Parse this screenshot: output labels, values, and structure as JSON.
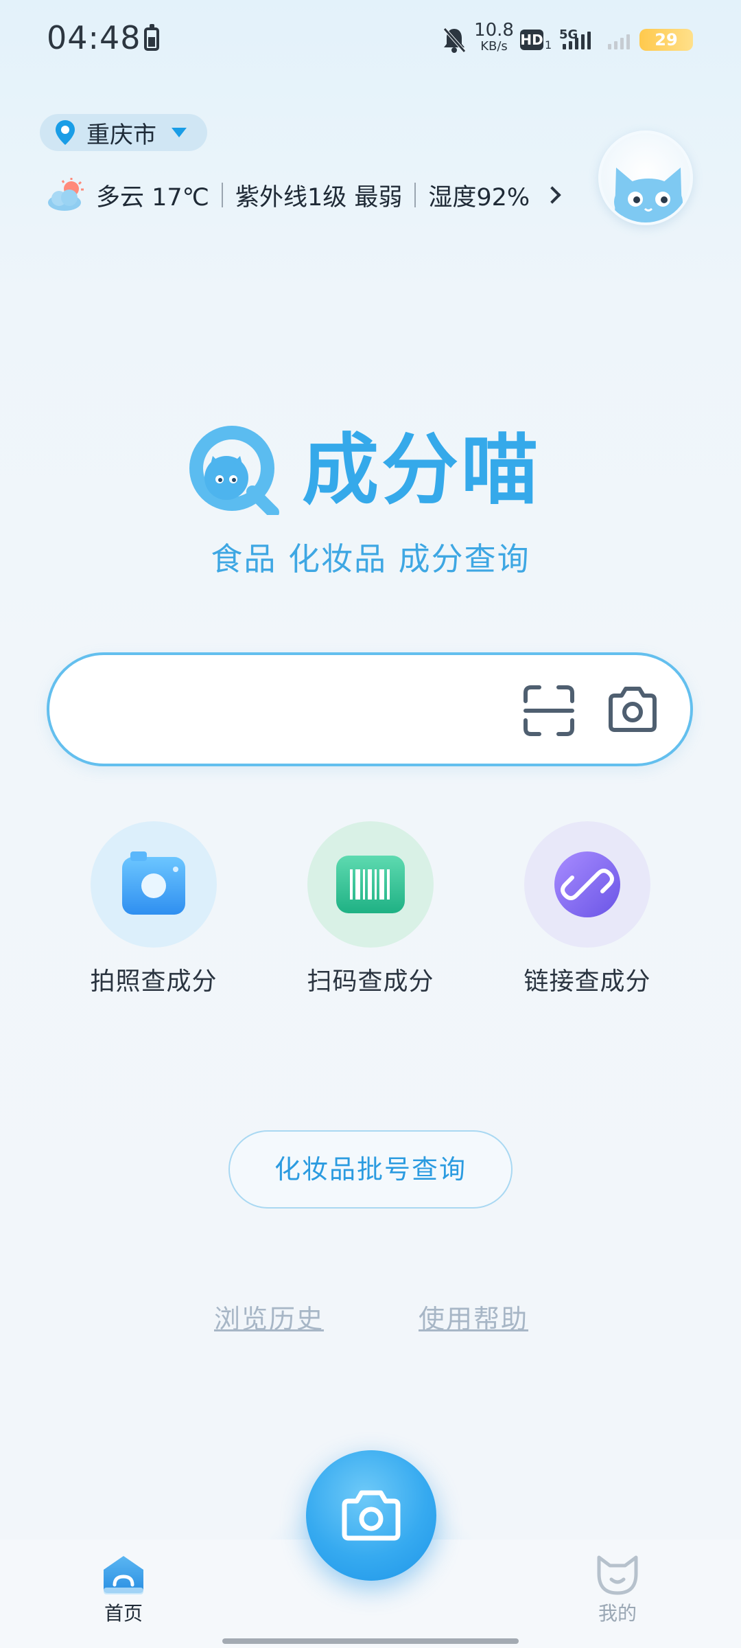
{
  "status_bar": {
    "time": "04:48",
    "net_speed_value": "10.8",
    "net_speed_unit": "KB/s",
    "hd_label": "HD",
    "hd_sub": "1",
    "network_type": "5G",
    "battery_level": "29"
  },
  "location": {
    "city": "重庆市"
  },
  "weather": {
    "condition": "多云 17℃",
    "uv": "紫外线1级 最弱",
    "humidity": "湿度92%"
  },
  "app": {
    "name": "成分喵",
    "tagline": "食品 化妆品 成分查询"
  },
  "search": {
    "placeholder": ""
  },
  "features": [
    {
      "label": "拍照查成分"
    },
    {
      "label": "扫码查成分"
    },
    {
      "label": "链接查成分"
    }
  ],
  "batch_query_label": "化妆品批号查询",
  "links": {
    "history": "浏览历史",
    "help": "使用帮助"
  },
  "bottom_nav": {
    "home_label": "首页",
    "mine_label": "我的"
  },
  "colors": {
    "accent": "#35a9ea",
    "search_border": "#63bfee",
    "batch_text": "#2b9be0",
    "link_gray": "#a7b6c6"
  }
}
